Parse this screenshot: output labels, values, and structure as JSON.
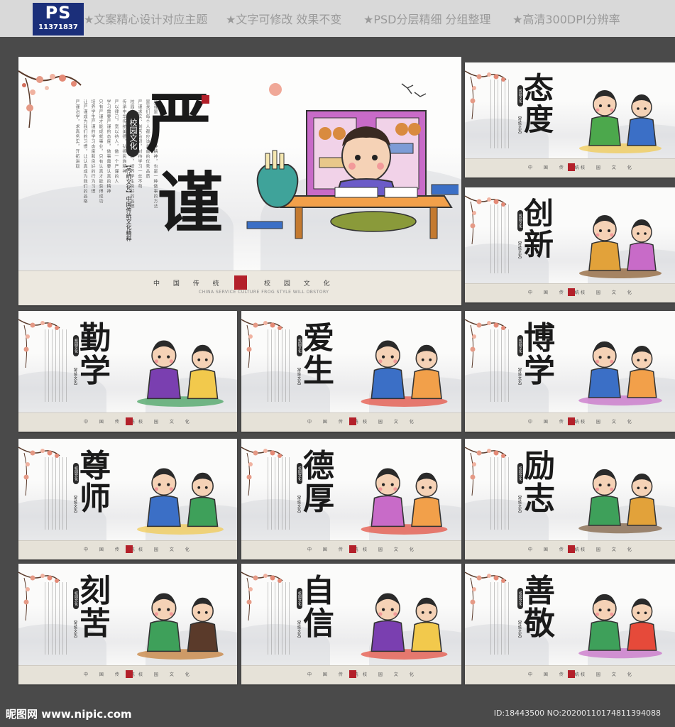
{
  "header": {
    "logo_text": "PS",
    "logo_number": "11371837",
    "features": [
      "★文案精心设计对应主题",
      "★文字可修改 效果不变",
      "★PSD分层精细 分组整理",
      "★高清300DPI分辨率"
    ]
  },
  "main_panel": {
    "title": [
      "严",
      "谨"
    ],
    "badge": "校园文化",
    "subtitle": "【传统文化】中国传统文化精粹",
    "body_lines": [
      "严谨是一种态度，一种精神，也是一种做事的方法",
      "是我们每个人都应该具备的优秀品质",
      "严谨求实、刻苦钻研，对待学习一丝不苟",
      "校园文化是学校精神的体现，培养学生良好的品德",
      "传承中华传统美德，弘扬民族精神",
      "严以律己，宽以待人，做一个严谨的人",
      "学习需要严谨的态度，做事需要认真的精神",
      "只有严谨才能成就事业，只有认真才能获得成功",
      "培养学生严谨的学习态度和良好的行为习惯",
      "让严谨成为我们的习惯，让认真成为我们的品格",
      "严谨治学，求真务实，开拓进取"
    ],
    "footer_left": "中 国 传 统",
    "footer_right": "校 园 文 化",
    "footer_english": "CHINA SERVICE CULTURE FROG STYLE WILL OBSTORY"
  },
  "panels": [
    {
      "id": "taidu",
      "title": [
        "态",
        "度"
      ]
    },
    {
      "id": "chuangxin",
      "title": [
        "创",
        "新"
      ]
    },
    {
      "id": "qinxue",
      "title": [
        "勤",
        "学"
      ]
    },
    {
      "id": "aisheng",
      "title": [
        "爱",
        "生"
      ]
    },
    {
      "id": "boxue",
      "title": [
        "博",
        "学"
      ]
    },
    {
      "id": "zunshi",
      "title": [
        "尊",
        "师"
      ]
    },
    {
      "id": "dehou",
      "title": [
        "德",
        "厚"
      ]
    },
    {
      "id": "lizhi",
      "title": [
        "励",
        "志"
      ]
    },
    {
      "id": "keku",
      "title": [
        "刻",
        "苦"
      ]
    },
    {
      "id": "zixin",
      "title": [
        "自",
        "信"
      ]
    },
    {
      "id": "shanjing",
      "title": [
        "善",
        "敬"
      ]
    }
  ],
  "small_panel_common": {
    "badge": "校园文化",
    "subtitle": "【传统文化】",
    "footer_left": "中 国 传 统",
    "footer_right": "校 园 文 化"
  },
  "watermark": {
    "left": "昵图网 www.nipic.com",
    "right": "ID:18443500 NO:20200110174811394088"
  },
  "colors": {
    "seal_red": "#b3202a",
    "logo_blue": "#1b2f7a",
    "background": "#4a4a4a"
  }
}
